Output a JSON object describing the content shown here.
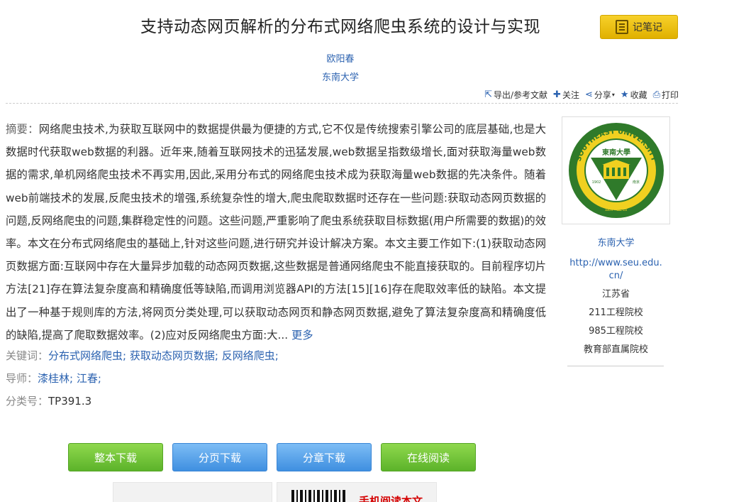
{
  "header": {
    "title": "支持动态网页解析的分布式网络爬虫系统的设计与实现",
    "note_button": "记笔记",
    "author": "欧阳春",
    "organization": "东南大学"
  },
  "toolbar": {
    "export": "导出/参考文献",
    "follow": "关注",
    "share": "分享",
    "collect": "收藏",
    "print": "打印"
  },
  "abstract": {
    "label": "摘要：",
    "text": "网络爬虫技术,为获取互联网中的数据提供最为便捷的方式,它不仅是传统搜索引擎公司的底层基础,也是大数据时代获取web数据的利器。近年来,随着互联网技术的迅猛发展,web数据呈指数级增长,面对获取海量web数据的需求,单机网络爬虫技术不再实用,因此,采用分布式的网络爬虫技术成为获取海量web数据的先决条件。随着web前端技术的发展,反爬虫技术的增强,系统复杂性的增大,爬虫爬取数据时还存在一些问题:获取动态网页数据的问题,反网络爬虫的问题,集群稳定性的问题。这些问题,严重影响了爬虫系统获取目标数据(用户所需要的数据)的效率。本文在分布式网络爬虫的基础上,针对这些问题,进行研究并设计解决方案。本文主要工作如下:(1)获取动态网页数据方面:互联网中存在大量异步加载的动态网页数据,这些数据是普通网络爬虫不能直接获取的。目前程序切片方法[21]存在算法复杂度高和精确度低等缺陷,而调用浏览器API的方法[15][16]存在爬取效率低的缺陷。本文提出了一种基于规则库的方法,将网页分类处理,可以获取动态网页和静态网页数据,避免了算法复杂度高和精确度低的缺陷,提高了爬取数据效率。(2)应对反网络爬虫方面:大...",
    "more": "更多"
  },
  "keywords": {
    "label": "关键词：",
    "items": [
      "分布式网络爬虫;",
      "获取动态网页数据;",
      "反网络爬虫;"
    ]
  },
  "tutor": {
    "label": "导师：",
    "items": [
      "漆桂林;",
      "江春;"
    ]
  },
  "classification": {
    "label": "分类号：",
    "value": "TP391.3"
  },
  "sidebar": {
    "logo_top_text": "SOUTHEAST UNIVERSITY",
    "logo_center_text": "東南大學",
    "logo_year": "1902",
    "logo_city": "南京",
    "logo_motto": "止於至善",
    "name": "东南大学",
    "url": "http://www.seu.edu.cn/",
    "province": "江苏省",
    "tag1": "211工程院校",
    "tag2": "985工程院校",
    "tag3": "教育部直属院校"
  },
  "downloads": {
    "full": "整本下载",
    "page": "分页下载",
    "chapter": "分章下载",
    "online": "在线阅读"
  },
  "bottom": {
    "mobile_read": "手机阅读本文"
  },
  "colors": {
    "link": "#2b62b0",
    "note_button": "#f2c40f",
    "green_button": "#6cc03a",
    "blue_button": "#4a98e6",
    "logo_green": "#2f7a2a",
    "logo_yellow": "#f0d020"
  }
}
